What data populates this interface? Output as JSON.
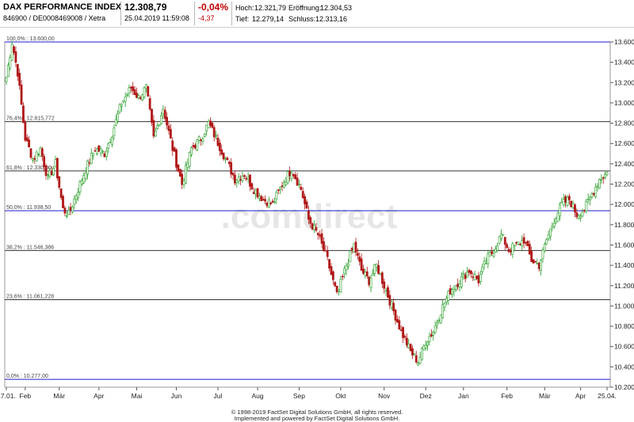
{
  "header": {
    "title": "DAX PERFORMANCE INDEX",
    "identifiers": "846900 / DE0008469008 / Xetra",
    "price": "12.308,79",
    "datetime": "25.04.2019 11:59:08",
    "change_pct": "-0,04%",
    "change_abs": "-4,37",
    "high_label": "Hoch:",
    "high_value": "12.321,79",
    "open_label": "Eröffnung:",
    "open_value": "12.304,53",
    "low_label": "Tief:",
    "low_value": "12.279,14",
    "close_label": "Schluss:",
    "close_value": "12.313,16"
  },
  "watermark": ".comdirect",
  "footer": {
    "line1": "© 1998-2019 FactSet Digital Solutions GmbH, all rights reserved.",
    "line2": "Implemented and powered by FactSet Digital Solutions GmbH."
  },
  "chart_data": {
    "type": "candlestick",
    "ylim": [
      10200,
      13600
    ],
    "y_ticks": [
      {
        "v": 10200,
        "label": "10.200"
      },
      {
        "v": 10400,
        "label": "10.400"
      },
      {
        "v": 10600,
        "label": "10.600"
      },
      {
        "v": 10800,
        "label": "10.800"
      },
      {
        "v": 11000,
        "label": "11.000"
      },
      {
        "v": 11200,
        "label": "11.200"
      },
      {
        "v": 11400,
        "label": "11.400"
      },
      {
        "v": 11600,
        "label": "11.600"
      },
      {
        "v": 11800,
        "label": "11.800"
      },
      {
        "v": 12000,
        "label": "12.000"
      },
      {
        "v": 12200,
        "label": "12.200"
      },
      {
        "v": 12400,
        "label": "12.400"
      },
      {
        "v": 12600,
        "label": "12.600"
      },
      {
        "v": 12800,
        "label": "12.800"
      },
      {
        "v": 13000,
        "label": "13.000"
      },
      {
        "v": 13200,
        "label": "13.200"
      },
      {
        "v": 13400,
        "label": "13.400"
      },
      {
        "v": 13600,
        "label": "13.600"
      }
    ],
    "x_labels": [
      "17.01.",
      "Feb",
      "Mär",
      "Apr",
      "Mai",
      "Jun",
      "Jul",
      "Aug",
      "Sep",
      "Okt",
      "Nov",
      "Dez",
      "Jan",
      "Feb",
      "Mär",
      "Apr",
      "25.04."
    ],
    "x_label_day_index": [
      0,
      10,
      28,
      49,
      69,
      90,
      112,
      133,
      155,
      177,
      200,
      222,
      242,
      265,
      285,
      304,
      318
    ],
    "fib_levels": [
      {
        "label": "100,0% : 13.600,00",
        "value": 13600,
        "color": "#1c1ccc"
      },
      {
        "label": "76,4% : 12.815,772",
        "value": 12815.772,
        "color": "#333333"
      },
      {
        "label": "61,8% : 12.330,00",
        "value": 12330,
        "color": "#333333"
      },
      {
        "label": "50,0% : 11.938,50",
        "value": 11938.5,
        "color": "#1c1ccc"
      },
      {
        "label": "38,2% : 11.546,386",
        "value": 11546.386,
        "color": "#333333"
      },
      {
        "label": "23,6% : 11.061,228",
        "value": 11061.228,
        "color": "#333333"
      },
      {
        "label": "0,0% : 10.277,00",
        "value": 10277,
        "color": "#1c1ccc"
      }
    ],
    "up_color": "#1f9a1f",
    "down_color": "#b01818",
    "anchors": [
      [
        0,
        13250
      ],
      [
        3,
        13600
      ],
      [
        6,
        13300
      ],
      [
        10,
        12650
      ],
      [
        14,
        12450
      ],
      [
        18,
        12550
      ],
      [
        22,
        12250
      ],
      [
        26,
        12400
      ],
      [
        30,
        11950
      ],
      [
        33,
        11900
      ],
      [
        38,
        12150
      ],
      [
        42,
        12350
      ],
      [
        47,
        12550
      ],
      [
        52,
        12500
      ],
      [
        56,
        12700
      ],
      [
        61,
        13000
      ],
      [
        66,
        13150
      ],
      [
        70,
        13050
      ],
      [
        74,
        13150
      ],
      [
        78,
        12650
      ],
      [
        83,
        12950
      ],
      [
        88,
        12550
      ],
      [
        93,
        12200
      ],
      [
        98,
        12550
      ],
      [
        103,
        12650
      ],
      [
        107,
        12800
      ],
      [
        111,
        12650
      ],
      [
        116,
        12450
      ],
      [
        121,
        12250
      ],
      [
        126,
        12300
      ],
      [
        131,
        12150
      ],
      [
        136,
        12050
      ],
      [
        141,
        12000
      ],
      [
        146,
        12200
      ],
      [
        151,
        12350
      ],
      [
        156,
        12150
      ],
      [
        160,
        11850
      ],
      [
        165,
        11700
      ],
      [
        170,
        11450
      ],
      [
        175,
        11100
      ],
      [
        180,
        11400
      ],
      [
        184,
        11600
      ],
      [
        188,
        11350
      ],
      [
        192,
        11250
      ],
      [
        196,
        11400
      ],
      [
        200,
        11200
      ],
      [
        205,
        10950
      ],
      [
        209,
        10750
      ],
      [
        214,
        10550
      ],
      [
        218,
        10450
      ],
      [
        222,
        10650
      ],
      [
        226,
        10750
      ],
      [
        230,
        10950
      ],
      [
        235,
        11150
      ],
      [
        240,
        11250
      ],
      [
        245,
        11350
      ],
      [
        250,
        11250
      ],
      [
        254,
        11450
      ],
      [
        258,
        11550
      ],
      [
        262,
        11700
      ],
      [
        266,
        11550
      ],
      [
        270,
        11600
      ],
      [
        274,
        11650
      ],
      [
        278,
        11450
      ],
      [
        282,
        11400
      ],
      [
        286,
        11650
      ],
      [
        290,
        11850
      ],
      [
        294,
        12000
      ],
      [
        298,
        12050
      ],
      [
        302,
        11900
      ],
      [
        306,
        11950
      ],
      [
        310,
        12100
      ],
      [
        314,
        12250
      ],
      [
        318,
        12310
      ]
    ]
  }
}
